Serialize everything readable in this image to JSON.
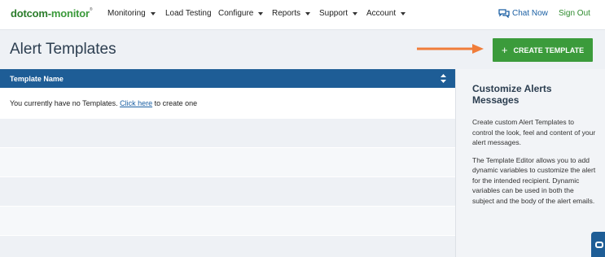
{
  "nav": {
    "logo_part1": "dotcom",
    "logo_dash": "-",
    "logo_part2": "monitor",
    "logo_mark": "®",
    "items": [
      {
        "label": "Monitoring",
        "dropdown": true
      },
      {
        "label": "Load Testing",
        "dropdown": false
      },
      {
        "label": "Configure",
        "dropdown": true
      },
      {
        "label": "Reports",
        "dropdown": true
      },
      {
        "label": "Support",
        "dropdown": true
      },
      {
        "label": "Account",
        "dropdown": true
      }
    ],
    "chat_label": "Chat Now",
    "chat_icon": "chat-bubbles-icon",
    "signout_label": "Sign Out"
  },
  "header": {
    "title": "Alert Templates",
    "create_button_label": "CREATE TEMPLATE",
    "create_button_icon": "+"
  },
  "table": {
    "column_header": "Template Name",
    "empty_prefix": "You currently have no Templates. ",
    "empty_link": "Click here",
    "empty_suffix": " to create one"
  },
  "side_panel": {
    "title": "Customize Alerts Messages",
    "paragraph1": "Create custom Alert Templates to control the look, feel and content of your alert messages.",
    "paragraph2": "The Template Editor allows you to add dynamic variables to customize the alert for the intended recipient. Dynamic variables can be used in both the subject and the body of the alert emails."
  },
  "colors": {
    "brand_green": "#3b9b3b",
    "header_blue": "#1e5d96",
    "arrow_orange": "#f07d3a"
  }
}
